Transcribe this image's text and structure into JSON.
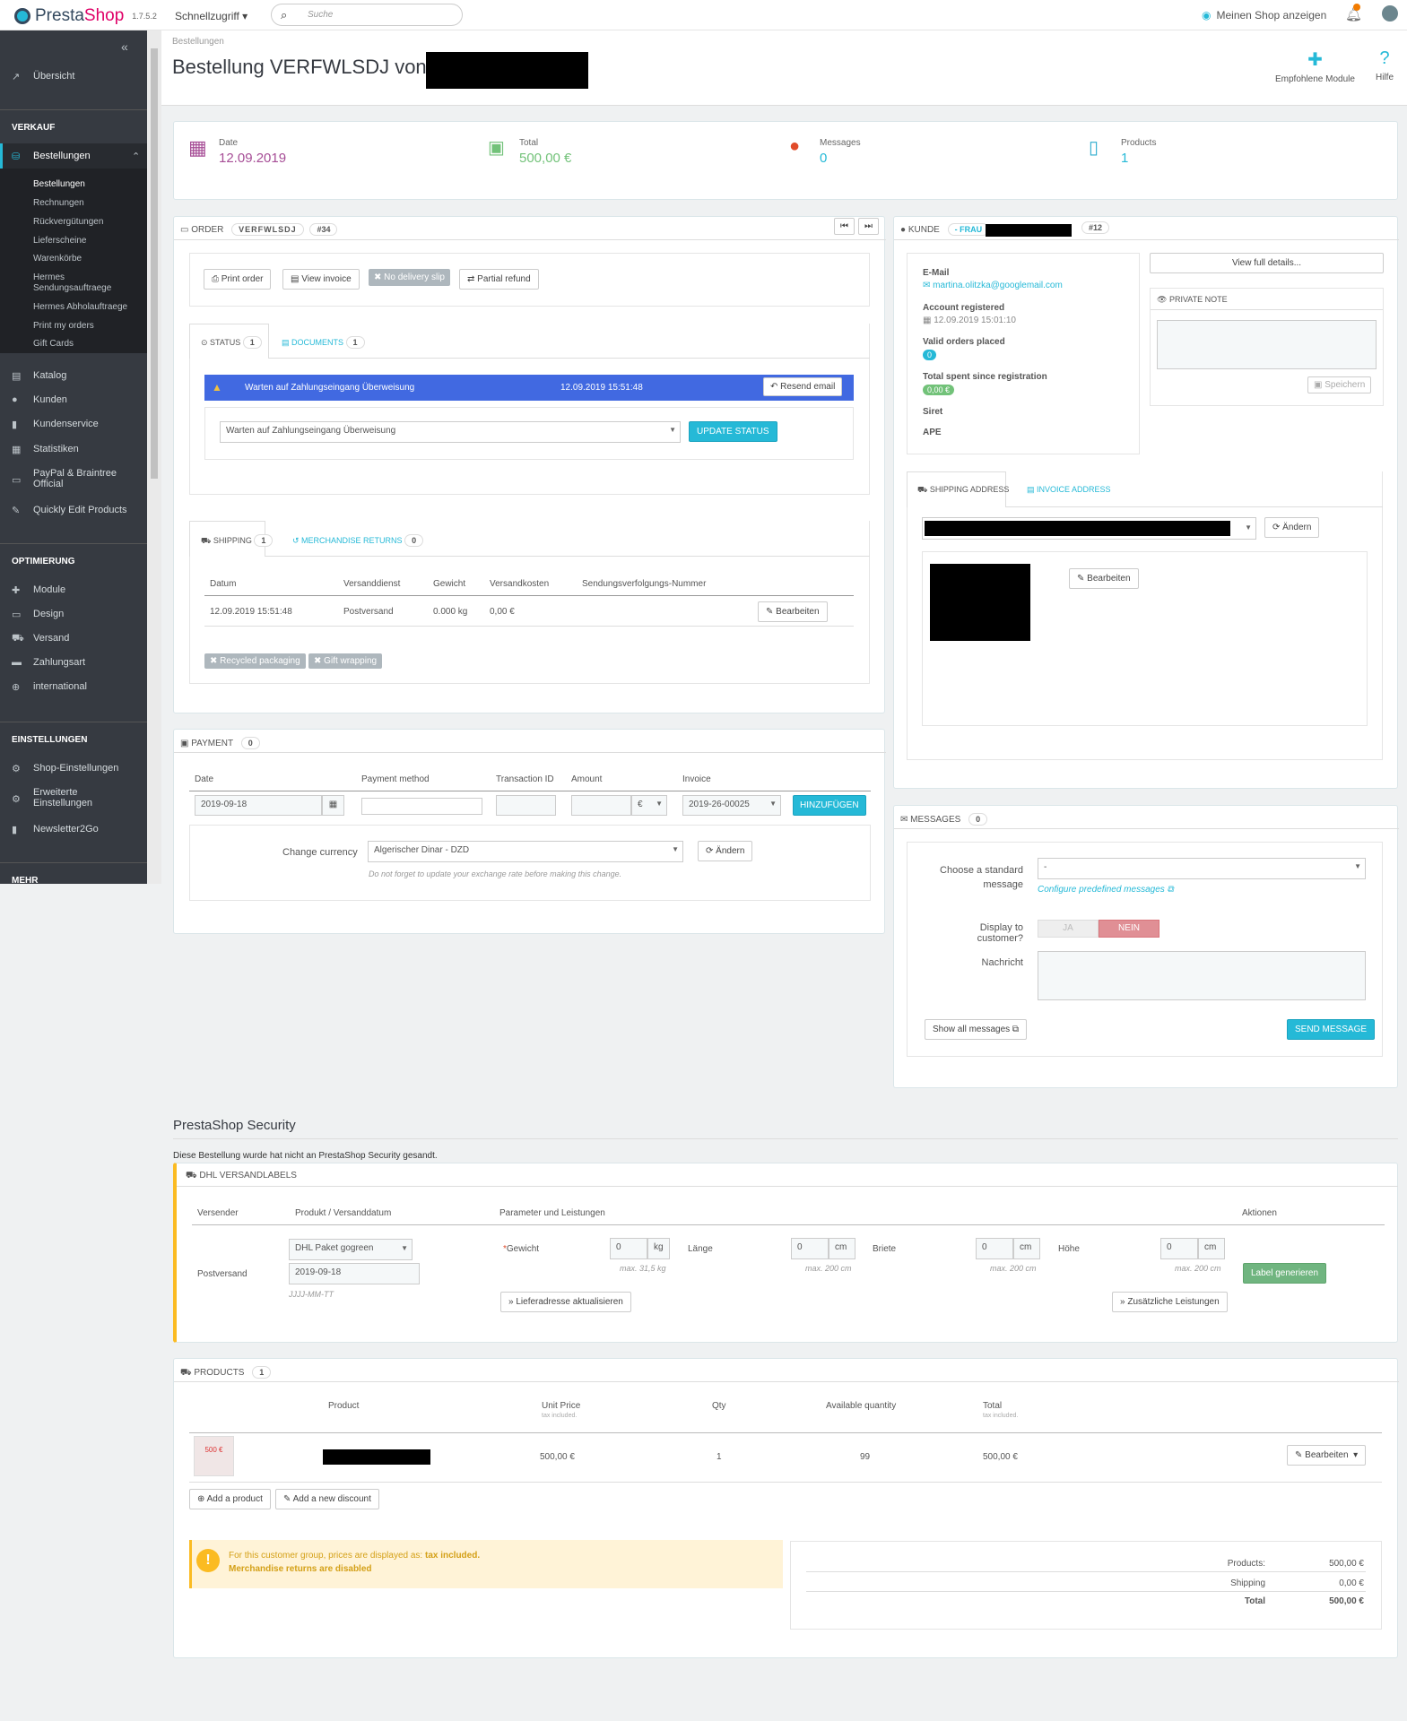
{
  "topbar": {
    "brand_a": "Presta",
    "brand_b": "Shop",
    "version": "1.7.5.2",
    "quick_access": "Schnellzugriff ▾",
    "search_placeholder": "Suche",
    "view_shop": "Meinen Shop anzeigen"
  },
  "sidebar": {
    "overview": "Übersicht",
    "sections": {
      "sell": "VERKAUF",
      "improve": "OPTIMIERUNG",
      "configure": "EINSTELLUNGEN",
      "more": "MEHR"
    },
    "orders": "Bestellungen",
    "orders_sub": [
      "Bestellungen",
      "Rechnungen",
      "Rückvergütungen",
      "Lieferscheine",
      "Warenkörbe",
      "Hermes Sendungsauftraege",
      "Hermes Abholauftraege",
      "Print my orders",
      "Gift Cards"
    ],
    "sell_items": [
      "Katalog",
      "Kunden",
      "Kundenservice",
      "Statistiken",
      "PayPal & Braintree Official",
      "Quickly Edit Products"
    ],
    "improve_items": [
      "Module",
      "Design",
      "Versand",
      "Zahlungsart",
      "international"
    ],
    "configure_items": [
      "Shop-Einstellungen",
      "Erweiterte Einstellungen",
      "Newsletter2Go"
    ]
  },
  "header": {
    "breadcrumb": "Bestellungen",
    "title": "Bestellung VERFWLSDJ von",
    "recommended_modules": "Empfohlene Module",
    "help": "Hilfe"
  },
  "kpis": {
    "date_label": "Date",
    "date_value": "12.09.2019",
    "total_label": "Total",
    "total_value": "500,00 €",
    "messages_label": "Messages",
    "messages_value": "0",
    "products_label": "Products",
    "products_value": "1"
  },
  "order": {
    "head": "ORDER",
    "reference": "VERFWLSDJ",
    "id": "#34",
    "buttons": {
      "print": "Print order",
      "invoice": "View invoice",
      "no_delivery": "No delivery slip",
      "partial_refund": "Partial refund"
    },
    "tabs": {
      "status": "STATUS",
      "status_count": "1",
      "documents": "DOCUMENTS",
      "documents_count": "1"
    },
    "status_row": {
      "text": "Warten auf Zahlungseingang Überweisung",
      "date": "12.09.2019 15:51:48",
      "resend": "Resend email"
    },
    "status_select": "Warten auf Zahlungseingang Überweisung",
    "update_status": "UPDATE STATUS",
    "shipping_tabs": {
      "shipping": "SHIPPING",
      "shipping_count": "1",
      "returns": "MERCHANDISE RETURNS",
      "returns_count": "0"
    },
    "shipping_headers": [
      "Datum",
      "Versanddienst",
      "Gewicht",
      "Versandkosten",
      "Sendungsverfolgungs-Nummer"
    ],
    "shipping_row": [
      "12.09.2019 15:51:48",
      "Postversand",
      "0.000 kg",
      "0,00 €"
    ],
    "edit": "Bearbeiten",
    "recycled": "Recycled packaging",
    "gift": "Gift wrapping"
  },
  "payment": {
    "head": "PAYMENT",
    "count": "0",
    "headers": [
      "Date",
      "Payment method",
      "Transaction ID",
      "Amount",
      "Invoice"
    ],
    "date_value": "2019-09-18",
    "currency": "€",
    "invoice_value": "2019-26-00025",
    "add": "HINZUFÜGEN",
    "change_currency_label": "Change currency",
    "currency_select": "Algerischer Dinar - DZD",
    "change": "Ändern",
    "hint": "Do not forget to update your exchange rate before making this change."
  },
  "customer": {
    "head": "KUNDE",
    "salutation": "- FRAU",
    "id": "#12",
    "email_label": "E-Mail",
    "email": "martina.olitzka@googlemail.com",
    "registered_label": "Account registered",
    "registered": "12.09.2019 15:01:10",
    "valid_orders_label": "Valid orders placed",
    "valid_orders": "0",
    "total_spent_label": "Total spent since registration",
    "total_spent": "0,00 €",
    "siret": "Siret",
    "ape": "APE",
    "view_details": "View full details...",
    "private_note": "PRIVATE NOTE",
    "save": "Speichern",
    "shipping_address": "SHIPPING ADDRESS",
    "invoice_address": "INVOICE ADDRESS",
    "change": "Ändern",
    "edit": "Bearbeiten"
  },
  "messages": {
    "head": "MESSAGES",
    "count": "0",
    "standard_label_1": "Choose a standard",
    "standard_label_2": "message",
    "standard_value": "-",
    "configure": "Configure predefined messages",
    "display_label": "Display to customer?",
    "yes": "JA",
    "no": "NEIN",
    "message_label": "Nachricht",
    "show_all": "Show all messages",
    "send": "SEND MESSAGE"
  },
  "security": {
    "title": "PrestaShop Security",
    "note": "Diese Bestellung wurde hat nicht an PrestaShop Security gesandt."
  },
  "dhl": {
    "head": "DHL VERSANDLABELS",
    "headers": [
      "Versender",
      "Produkt / Versanddatum",
      "Parameter und Leistungen",
      "Aktionen"
    ],
    "sender": "Postversand",
    "product": "DHL Paket gogreen",
    "date": "2019-09-18",
    "date_hint": "JJJJ-MM-TT",
    "weight_label": "Gewicht",
    "length_label": "Länge",
    "width_label": "Briete",
    "height_label": "Höhe",
    "weight_val": "0",
    "weight_unit": "kg",
    "weight_hint": "max. 31,5 kg",
    "length_val": "0",
    "length_unit": "cm",
    "length_hint": "max. 200 cm",
    "width_val": "0",
    "width_unit": "cm",
    "width_hint": "max. 200 cm",
    "height_val": "0",
    "height_unit": "cm",
    "height_hint": "max. 200 cm",
    "update_address": "Lieferadresse aktualisieren",
    "extra_services": "Zusätzliche Leistungen",
    "generate": "Label generieren"
  },
  "products": {
    "head": "PRODUCTS",
    "count": "1",
    "headers": {
      "product": "Product",
      "unit_price": "Unit Price",
      "tax_incl": "tax included.",
      "qty": "Qty",
      "available": "Available quantity",
      "total": "Total"
    },
    "row": {
      "thumb_text": "500 €",
      "unit_price": "500,00 €",
      "qty": "1",
      "available": "99",
      "total": "500,00 €"
    },
    "edit": "Bearbeiten",
    "add_product": "Add a product",
    "add_discount": "Add a new discount",
    "warn_1a": "For this customer group, prices are displayed as: ",
    "warn_1b": "tax included.",
    "warn_2": "Merchandise returns are disabled",
    "totals": [
      {
        "label": "Products:",
        "value": "500,00 €"
      },
      {
        "label": "Shipping",
        "value": "0,00 €"
      },
      {
        "label": "Total",
        "value": "500,00 €"
      }
    ]
  }
}
